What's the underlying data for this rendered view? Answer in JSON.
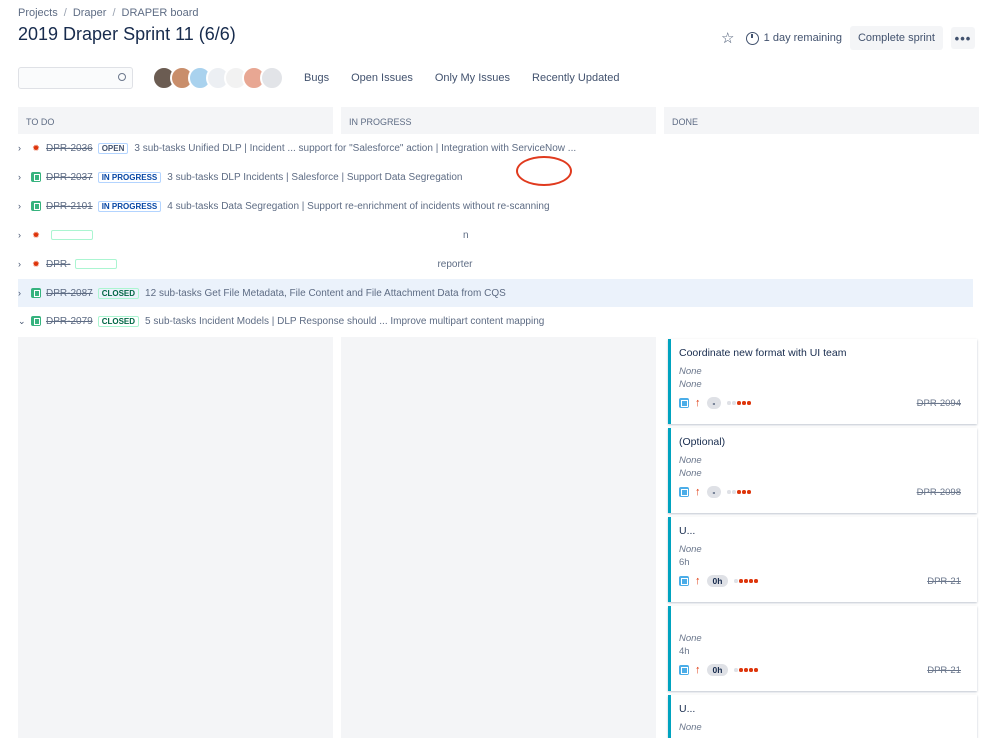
{
  "breadcrumb": {
    "items": [
      "Projects",
      "Draper",
      "DRAPER board"
    ],
    "separator": "/"
  },
  "title": "2019 Draper Sprint 11 (6/6)",
  "header": {
    "remaining": "1 day remaining",
    "complete_label": "Complete sprint",
    "more_label": "•••"
  },
  "filters": [
    "Bugs",
    "Open Issues",
    "Only My Issues",
    "Recently Updated"
  ],
  "columns": [
    "TO DO",
    "IN PROGRESS",
    "DONE"
  ],
  "swimlanes": [
    {
      "key": "DPR-2036",
      "type": "bug",
      "status": "OPEN",
      "summary": "3 sub-tasks Unified DLP | Incident ... support for \"Salesforce\" action | Integration with ServiceNow ..."
    },
    {
      "key": "DPR-2037",
      "type": "story",
      "status": "IN PROGRESS",
      "summary": "3 sub-tasks DLP Incidents | Salesforce | Support Data Segregation"
    },
    {
      "key": "DPR-2101",
      "type": "story",
      "status": "IN PROGRESS",
      "summary": "4 sub-tasks Data Segregation | Support re-enrichment of incidents without re-scanning"
    },
    {
      "key": "",
      "type": "bug",
      "status": "",
      "summary": "n"
    },
    {
      "key": "DPR-",
      "type": "bug",
      "status": "",
      "summary": "reporter"
    },
    {
      "key": "DPR-2087",
      "type": "story",
      "status": "CLOSED",
      "summary": "12 sub-tasks Get File Metadata, File Content and File Attachment Data from CQS"
    },
    {
      "key": "DPR-2079",
      "type": "story",
      "status": "CLOSED",
      "summary": "5 sub-tasks Incident Models | DLP Response should ... Improve multipart content mapping"
    }
  ],
  "cards": [
    {
      "title": "Coordinate new format with UI team",
      "meta1": "None",
      "meta2": "None",
      "estimate": "-",
      "key": "DPR-2094"
    },
    {
      "title": "(Optional)",
      "meta1": "None",
      "meta2": "None",
      "estimate": "-",
      "key": "DPR-2098"
    },
    {
      "title": "U...",
      "meta1": "None",
      "meta2": "6h",
      "estimate": "0h",
      "key": "DPR-21"
    },
    {
      "title": "",
      "meta1": "None",
      "meta2": "4h",
      "estimate": "0h",
      "key": "DPR-21"
    },
    {
      "title": "U...",
      "meta1": "None",
      "meta2": "",
      "estimate": "",
      "key": ""
    }
  ],
  "colors": {
    "accent": "#00a3bf",
    "priority": "#de350b",
    "annotation": "#e03a1e",
    "highlight_row": "#ebf2fb"
  }
}
